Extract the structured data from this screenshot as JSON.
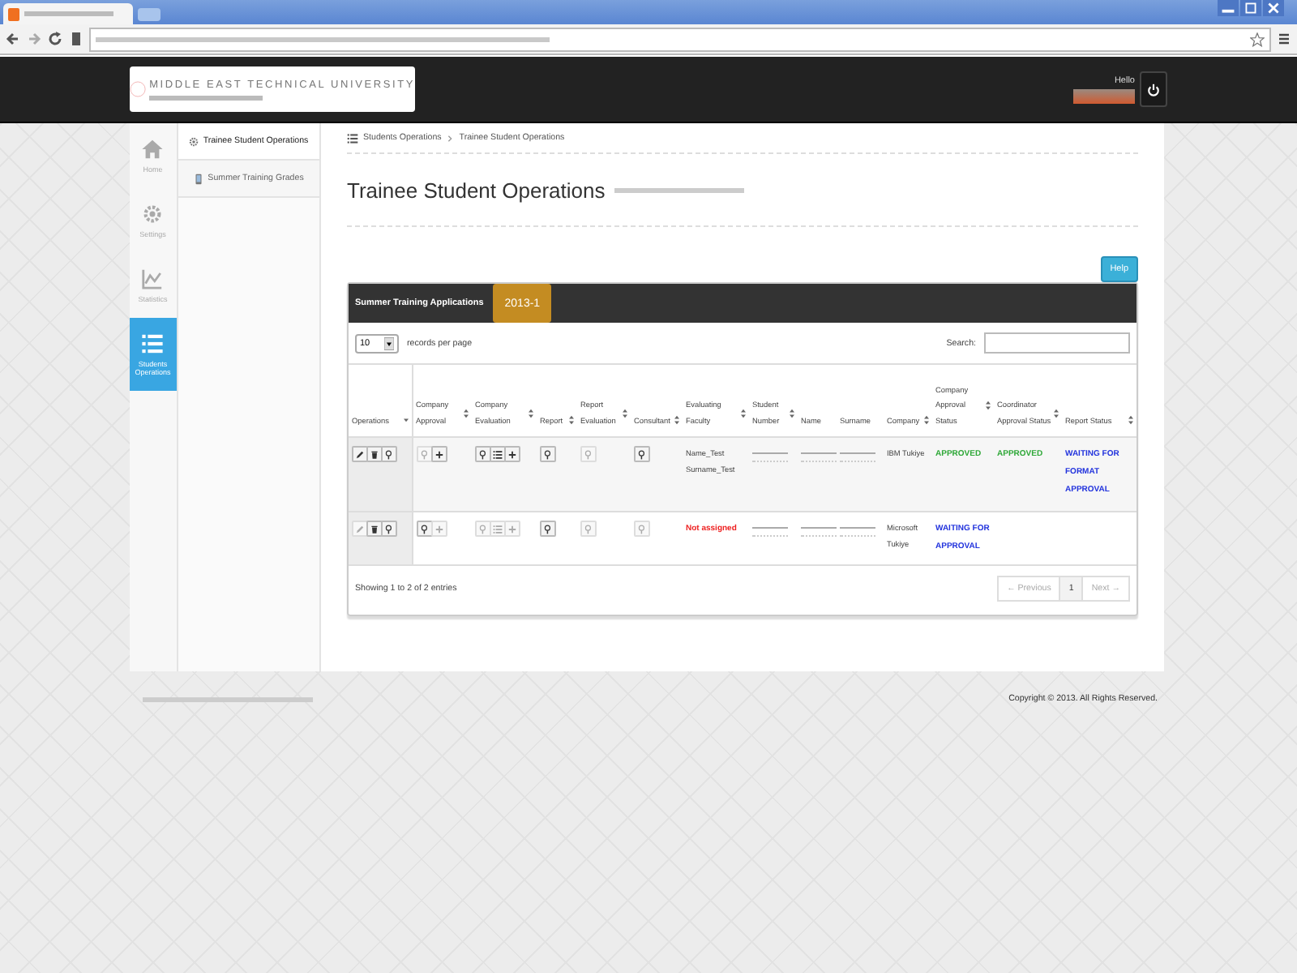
{
  "header": {
    "logo_text": "MIDDLE EAST TECHNICAL UNIVERSITY",
    "greeting": "Hello"
  },
  "sidebar": {
    "items": [
      {
        "kind": "home",
        "label": "Home",
        "selected": false
      },
      {
        "kind": "gear",
        "label": "Settings",
        "selected": false
      },
      {
        "kind": "chart",
        "label": "Statistics",
        "selected": false
      },
      {
        "kind": "list",
        "label": "Students Operations",
        "selected": true
      }
    ]
  },
  "submenu": {
    "items": [
      {
        "kind": "gear",
        "label": "Trainee Student Operations",
        "selected": true
      },
      {
        "kind": "device",
        "label": "Summer Training Grades",
        "selected": false
      }
    ]
  },
  "breadcrumb": [
    "Students Operations",
    "Trainee Student Operations"
  ],
  "page_title": "Trainee Student Operations",
  "help_button": "Help",
  "panel": {
    "title": "Summer Training Applications",
    "term": "2013-1",
    "page_size": "10",
    "page_size_label": "records per page",
    "search_label": "Search:",
    "columns": [
      {
        "label": "Operations",
        "kind": "sorted"
      },
      {
        "label": "Company Approval",
        "kind": "sortable"
      },
      {
        "label": "Company Evaluation",
        "kind": "sortable"
      },
      {
        "label": "Report",
        "kind": "sortable"
      },
      {
        "label": "Report Evaluation",
        "kind": "sortable"
      },
      {
        "label": "Consultant",
        "kind": "sortable"
      },
      {
        "label": "Evaluating Faculty",
        "kind": "sortable"
      },
      {
        "label": "Student Number",
        "kind": "sortable"
      },
      {
        "label": "Name",
        "kind": "plain"
      },
      {
        "label": "Surname",
        "kind": "plain"
      },
      {
        "label": "Company",
        "kind": "sortable"
      },
      {
        "label": "Company Approval Status",
        "kind": "sortable"
      },
      {
        "label": "Coordinator Approval Status",
        "kind": "sortable"
      },
      {
        "label": "Report Status",
        "kind": "sortable"
      }
    ],
    "rows": [
      {
        "striped": true,
        "cells": [
          {
            "kind": "buttons",
            "buttons": [
              {
                "kind": "pencil",
                "disabled": false
              },
              {
                "kind": "trash",
                "disabled": false
              },
              {
                "kind": "search",
                "disabled": false
              }
            ]
          },
          {
            "kind": "buttons",
            "buttons": [
              {
                "kind": "search",
                "disabled": true
              },
              {
                "kind": "plus",
                "disabled": false
              }
            ]
          },
          {
            "kind": "buttons",
            "buttons": [
              {
                "kind": "search",
                "disabled": false
              },
              {
                "kind": "list",
                "disabled": false
              },
              {
                "kind": "plus",
                "disabled": false
              }
            ]
          },
          {
            "kind": "buttons",
            "buttons": [
              {
                "kind": "search",
                "disabled": false
              }
            ]
          },
          {
            "kind": "buttons",
            "buttons": [
              {
                "kind": "search",
                "disabled": true
              }
            ]
          },
          {
            "kind": "buttons",
            "buttons": [
              {
                "kind": "search",
                "disabled": false
              }
            ]
          },
          {
            "kind": "text",
            "text": "Name_Test Surname_Test"
          },
          {
            "kind": "redacted"
          },
          {
            "kind": "redacted"
          },
          {
            "kind": "redacted"
          },
          {
            "kind": "text",
            "text": "IBM Tukiye"
          },
          {
            "kind": "text",
            "text": "APPROVED",
            "color": "#2fa838"
          },
          {
            "kind": "text",
            "text": "APPROVED",
            "color": "#2fa838"
          },
          {
            "kind": "text",
            "text": "WAITING FOR FORMAT APPROVAL",
            "color": "#2233dd"
          }
        ]
      },
      {
        "striped": false,
        "cells": [
          {
            "kind": "buttons",
            "buttons": [
              {
                "kind": "pencil",
                "disabled": true
              },
              {
                "kind": "trash",
                "disabled": false
              },
              {
                "kind": "search",
                "disabled": false
              }
            ]
          },
          {
            "kind": "buttons",
            "buttons": [
              {
                "kind": "search",
                "disabled": false
              },
              {
                "kind": "plus",
                "disabled": true
              }
            ]
          },
          {
            "kind": "buttons",
            "buttons": [
              {
                "kind": "search",
                "disabled": true
              },
              {
                "kind": "list",
                "disabled": true
              },
              {
                "kind": "plus",
                "disabled": true
              }
            ]
          },
          {
            "kind": "buttons",
            "buttons": [
              {
                "kind": "search",
                "disabled": false
              }
            ]
          },
          {
            "kind": "buttons",
            "buttons": [
              {
                "kind": "search",
                "disabled": true
              }
            ]
          },
          {
            "kind": "buttons",
            "buttons": [
              {
                "kind": "search",
                "disabled": true
              }
            ]
          },
          {
            "kind": "text",
            "text": "Not assigned",
            "color": "#ee2222"
          },
          {
            "kind": "redacted"
          },
          {
            "kind": "redacted"
          },
          {
            "kind": "redacted"
          },
          {
            "kind": "text",
            "text": "Microsoft Tukiye"
          },
          {
            "kind": "text",
            "text": "WAITING FOR APPROVAL",
            "color": "#2233dd"
          },
          {
            "kind": "empty"
          },
          {
            "kind": "empty"
          }
        ]
      }
    ],
    "info": "Showing 1 to 2 of 2 entries",
    "pagination": [
      {
        "label": "← Previous",
        "disabled": true,
        "selected": false
      },
      {
        "label": "1",
        "disabled": false,
        "selected": true
      },
      {
        "label": "Next →",
        "disabled": true,
        "selected": false
      }
    ]
  },
  "footer": {
    "copyright": "Copyright © 2013. All Rights Reserved."
  }
}
